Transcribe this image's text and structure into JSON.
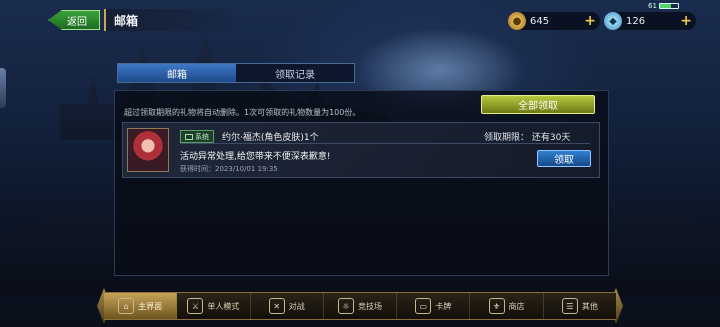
{
  "status": {
    "battery": "61",
    "battery_level": 0.61
  },
  "header": {
    "back_label": "返回",
    "title": "邮箱"
  },
  "resources": [
    {
      "name": "gold",
      "icon": "gold-coin-icon",
      "value": "645"
    },
    {
      "name": "gem",
      "icon": "crystal-icon",
      "value": "126"
    }
  ],
  "tabs": [
    {
      "label": "邮箱",
      "active": true
    },
    {
      "label": "领取记录",
      "active": false
    }
  ],
  "mailbox": {
    "notice": "超过领取期限的礼物将自动删除。1次可领取的礼物数量为100份。",
    "claim_all_label": "全部领取",
    "mails": [
      {
        "tag": "系统",
        "subject": "约尔·福杰(角色皮肤)1个",
        "body": "活动异常处理,给您带来不便深表歉意!",
        "date": "获得时间：2023/10/01 19:35",
        "expire": "领取期限：  还有30天",
        "claim_label": "领取"
      }
    ]
  },
  "nav": [
    {
      "label": "主界面",
      "icon": "home-icon",
      "active": true
    },
    {
      "label": "单人模式",
      "icon": "sword-icon",
      "active": false
    },
    {
      "label": "对战",
      "icon": "crossed-swords-icon",
      "active": false
    },
    {
      "label": "竞技场",
      "icon": "arena-icon",
      "active": false
    },
    {
      "label": "卡牌",
      "icon": "cards-icon",
      "active": false
    },
    {
      "label": "商店",
      "icon": "shop-icon",
      "active": false
    },
    {
      "label": "其他",
      "icon": "more-icon",
      "active": false
    }
  ],
  "colors": {
    "accent_green": "#3aa23a",
    "accent_blue": "#2f7fd0",
    "gold": "#c6a256"
  }
}
